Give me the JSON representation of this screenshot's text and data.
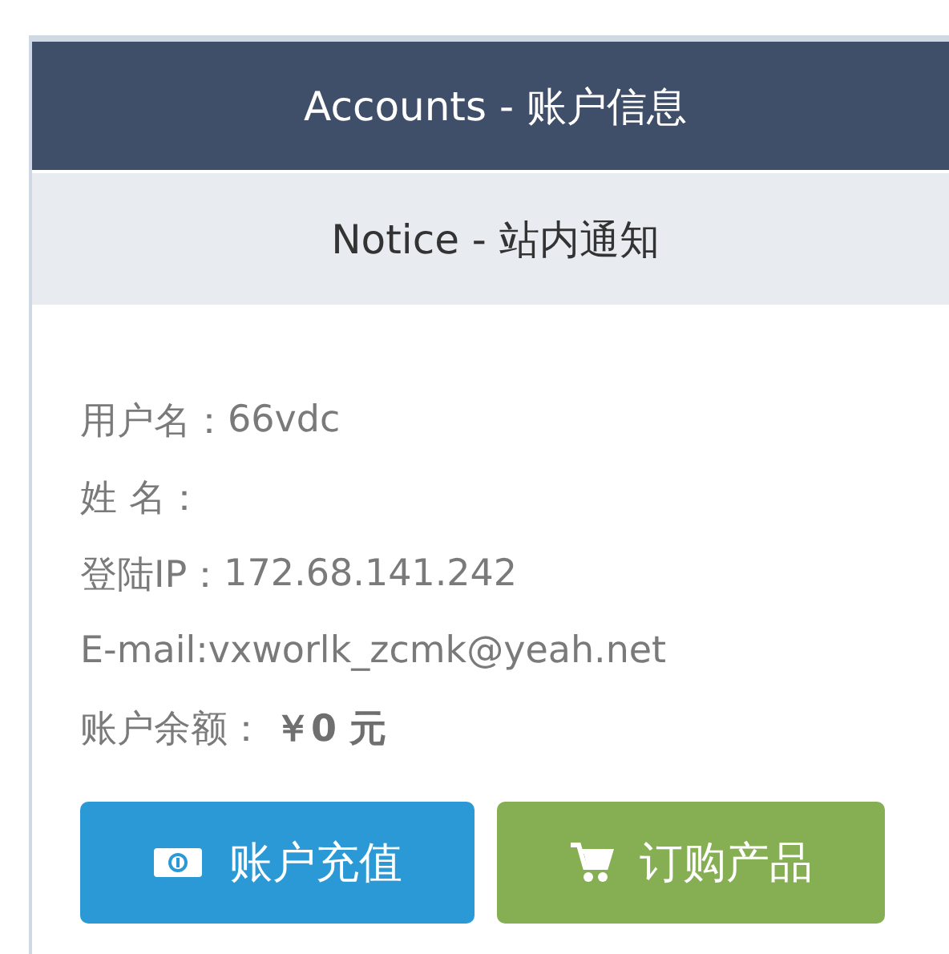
{
  "header": {
    "title": "Accounts - 账户信息"
  },
  "notice": {
    "title": "Notice - 站内通知"
  },
  "info": [
    {
      "label": "用户名：",
      "value": "66vdc",
      "kind": "plain"
    },
    {
      "label": "姓 名："
    },
    {
      "label": "登陆IP：",
      "value": "172.68.141.242",
      "kind": "plain"
    },
    {
      "label": "E-mail:",
      "value": "vxworlk_zcmk@yeah.net",
      "kind": "plain"
    },
    {
      "label": "账户余额：",
      "value": "￥0 元",
      "kind": "amount"
    }
  ],
  "buttons": [
    {
      "label": "账户充值",
      "kind": "recharge"
    },
    {
      "label": "订购产品",
      "kind": "order"
    }
  ]
}
